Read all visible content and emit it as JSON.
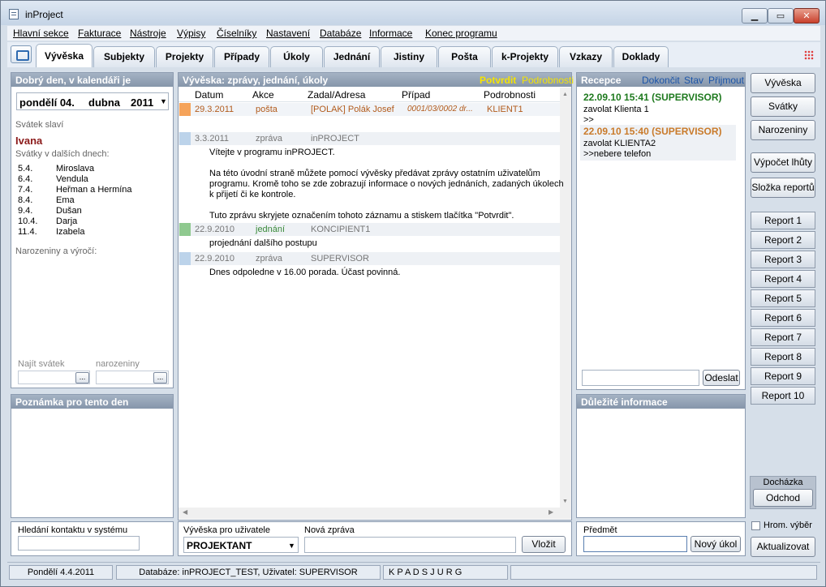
{
  "window": {
    "title": "inProject"
  },
  "menu": [
    "Hlavní sekce",
    "Fakturace",
    "Nástroje",
    "Výpisy",
    "Číselníky",
    "Nastavení",
    "Databáze",
    "Informace",
    "Konec programu"
  ],
  "tabs": [
    "Vývěska",
    "Subjekty",
    "Projekty",
    "Případy",
    "Úkoly",
    "Jednání",
    "Jistiny",
    "Pošta",
    "k-Projekty",
    "Vzkazy",
    "Doklady"
  ],
  "calendar": {
    "header": "Dobrý den, v kalendáři je",
    "date_day": "pondělí 04.",
    "date_month": "dubna",
    "date_year": "2011",
    "nameday_label": "Svátek slaví",
    "nameday_name": "Ivana",
    "next_label": "Svátky v dalších dnech:",
    "next": [
      {
        "d": "5.4.",
        "n": "Miroslava"
      },
      {
        "d": "6.4.",
        "n": "Vendula"
      },
      {
        "d": "7.4.",
        "n": "Heřman a Hermína"
      },
      {
        "d": "8.4.",
        "n": "Ema"
      },
      {
        "d": "9.4.",
        "n": "Dušan"
      },
      {
        "d": "10.4.",
        "n": "Darja"
      },
      {
        "d": "11.4.",
        "n": "Izabela"
      }
    ],
    "birthday_label": "Narozeniny a výročí:",
    "find_holiday": "Najít svátek",
    "birthdays": "narozeniny",
    "dots": "..."
  },
  "note": {
    "header": "Poznámka pro tento den"
  },
  "contact_search": {
    "label": "Hledání kontaktu v systému"
  },
  "board": {
    "header": "Vývěska: zprávy, jednání, úkoly",
    "confirm": "Potvrdit",
    "details": "Podrobnosti",
    "columns": [
      "Datum",
      "Akce",
      "Zadal/Adresa",
      "Případ",
      "Podrobnosti"
    ],
    "rows": [
      {
        "date": "29.3.2011",
        "action": "pošta",
        "by": "[POLAK] Polák Josef",
        "case": "0001/03/0002 dr...",
        "detail": "KLIENT1",
        "color": "#f5a35a"
      },
      {
        "date": "3.3.2011",
        "action": "zpráva",
        "by": "inPROJECT",
        "case": "",
        "detail": "",
        "color": "#bcd3ea"
      },
      {
        "date": "22.9.2010",
        "action": "jednání",
        "by": "KONCIPIENT1",
        "case": "",
        "detail": "",
        "color": "#8fc98f"
      },
      {
        "date": "22.9.2010",
        "action": "zpráva",
        "by": "SUPERVISOR",
        "case": "",
        "detail": "",
        "color": "#bcd3ea"
      }
    ],
    "msg1": [
      "Vítejte v programu inPROJECT.",
      "",
      "Na této úvodní straně můžete pomocí vývěsky předávat zprávy ostatním uživatelům",
      "programu. Kromě toho se zde zobrazují informace o nových jednáních, zadaných úkolech",
      "k přijetí či ke kontrole.",
      "",
      "Tuto zprávu skryjete označením tohoto záznamu a stiskem tlačítka \"Potvrdit\"."
    ],
    "msg2": "projednání dalšího postupu",
    "msg3": "Dnes odpoledne v 16.00 porada. Účast povinná.",
    "for_user_label": "Vývěska pro uživatele",
    "for_user_value": "PROJEKTANT",
    "new_msg_label": "Nová zpráva",
    "insert_btn": "Vložit"
  },
  "reception": {
    "header": "Recepce",
    "finish": "Dokončit",
    "state": "Stav",
    "receive": "Přijmout",
    "items": [
      {
        "time": "22.09.10 15:41 (SUPERVISOR)",
        "text": "zavolat Klienta 1",
        "extra": ">>",
        "color": "#1f7a1f"
      },
      {
        "time": "22.09.10 15:40 (SUPERVISOR)",
        "text": "zavolat KLIENTA2",
        "extra": ">>nebere telefon",
        "color": "#c97a2a"
      }
    ],
    "send_btn": "Odeslat"
  },
  "important": {
    "header": "Důležité informace",
    "subject_label": "Předmět",
    "new_task_btn": "Nový úkol"
  },
  "right": {
    "buttons": [
      "Vývěska",
      "Svátky",
      "Narozeniny"
    ],
    "calc": "Výpočet lhůty",
    "folder": "Složka reportů",
    "reports": [
      "Report 1",
      "Report 2",
      "Report 3",
      "Report 4",
      "Report 5",
      "Report 6",
      "Report 7",
      "Report 8",
      "Report 9",
      "Report 10"
    ],
    "attendance": "Docházka",
    "leave": "Odchod",
    "bulk": "Hrom. výběr",
    "refresh": "Aktualizovat"
  },
  "status": {
    "date": "Pondělí 4.4.2011",
    "db": "Databáze: inPROJECT_TEST, Uživatel: SUPERVISOR",
    "letters": "K  P  A  D  S  J  U  R  G"
  }
}
